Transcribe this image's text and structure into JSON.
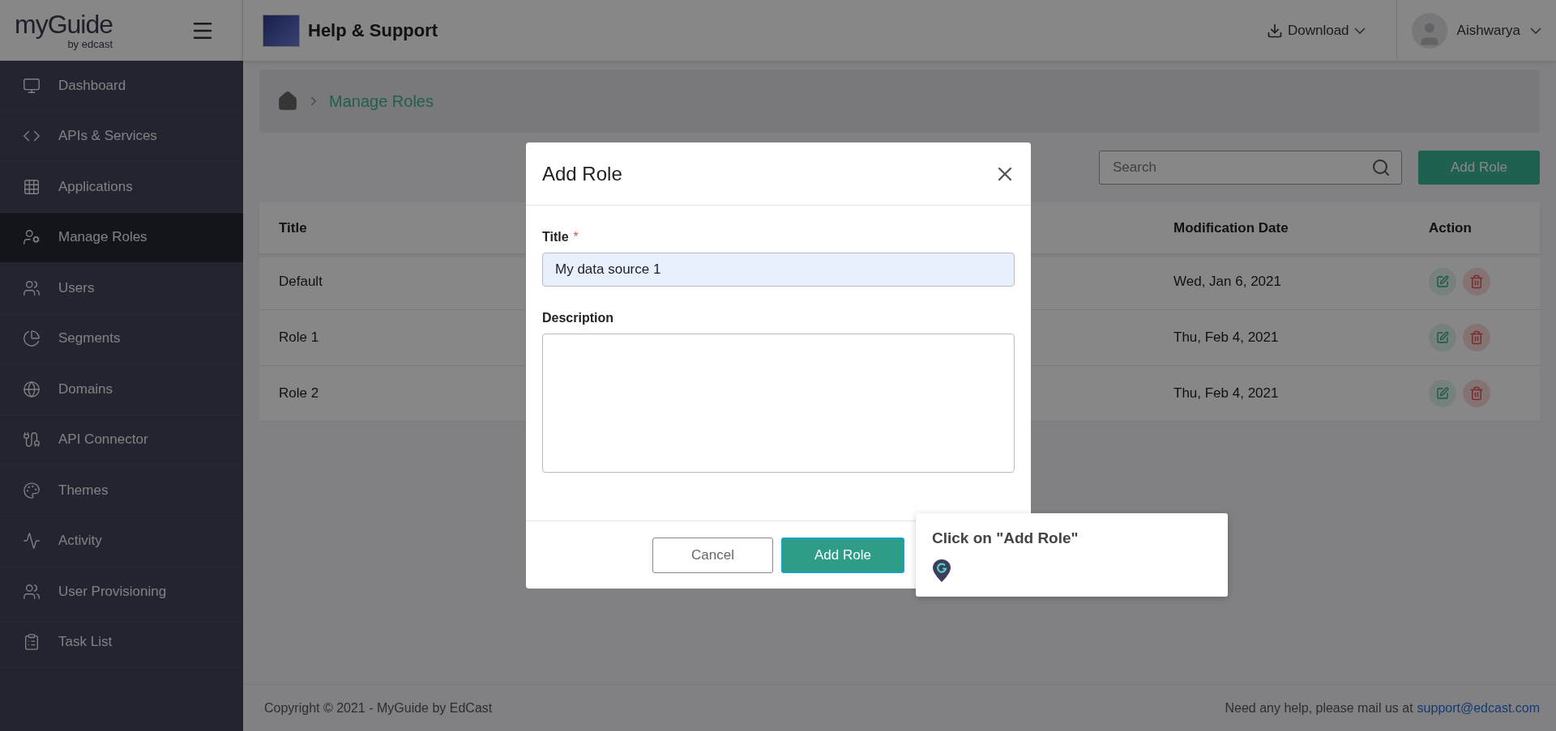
{
  "logo": {
    "word": "myGuide",
    "tagline": "by edcast"
  },
  "header": {
    "app_title": "Help & Support",
    "download": "Download",
    "user": "Aishwarya"
  },
  "sidebar": {
    "items": [
      {
        "label": "Dashboard",
        "selected": false
      },
      {
        "label": "APIs & Services",
        "selected": false
      },
      {
        "label": "Applications",
        "selected": false
      },
      {
        "label": "Manage Roles",
        "selected": true
      },
      {
        "label": "Users",
        "selected": false
      },
      {
        "label": "Segments",
        "selected": false
      },
      {
        "label": "Domains",
        "selected": false
      },
      {
        "label": "API Connector",
        "selected": false
      },
      {
        "label": "Themes",
        "selected": false
      },
      {
        "label": "Activity",
        "selected": false
      },
      {
        "label": "User Provisioning",
        "selected": false
      },
      {
        "label": "Task List",
        "selected": false
      }
    ]
  },
  "breadcrumb": {
    "current": "Manage Roles"
  },
  "toolbar": {
    "search": {
      "placeholder": "Search"
    },
    "add_button": "Add Role"
  },
  "table": {
    "columns": [
      "Title",
      "Modification Date",
      "Action"
    ],
    "rows": [
      {
        "title": "Default",
        "modified": "Wed, Jan 6, 2021"
      },
      {
        "title": "Role 1",
        "modified": "Thu, Feb 4, 2021"
      },
      {
        "title": "Role 2",
        "modified": "Thu, Feb 4, 2021"
      }
    ]
  },
  "modal": {
    "title": "Add Role",
    "fields": [
      {
        "kind": "input",
        "label": "Title",
        "required_mark": "*",
        "value": "My data source 1"
      },
      {
        "kind": "textarea",
        "label": "Description"
      }
    ],
    "buttons": [
      {
        "label": "Cancel",
        "kind": "secondary"
      },
      {
        "label": "Add Role",
        "kind": "primary"
      }
    ]
  },
  "tooltip": {
    "text": "Click on \"Add Role\""
  },
  "footer": {
    "copyright": "Copyright © 2021 - MyGuide by EdCast",
    "help": "Need any help, please mail us at",
    "email": "support@edcast.com"
  }
}
